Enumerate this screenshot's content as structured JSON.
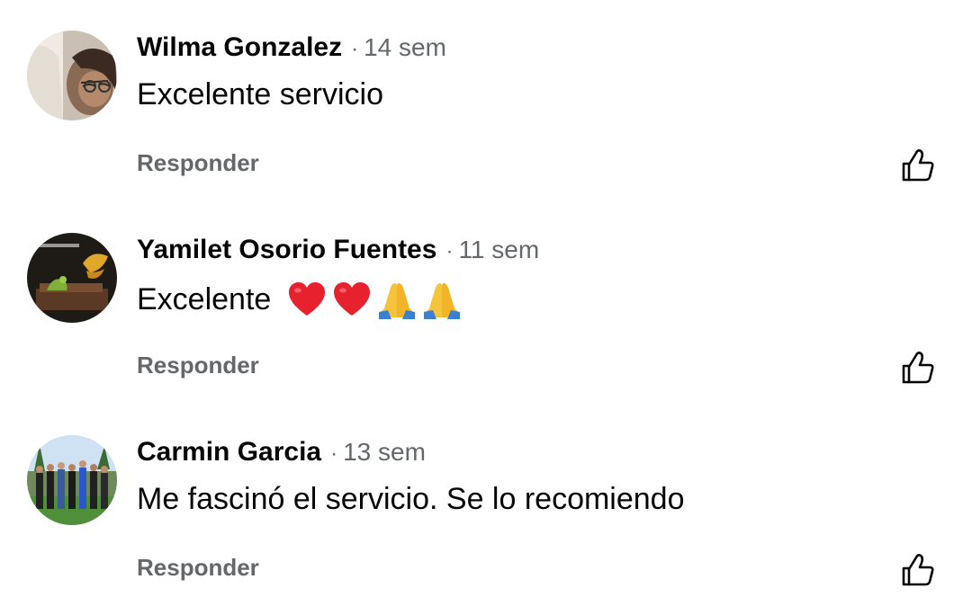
{
  "comments": [
    {
      "author": "Wilma Gonzalez",
      "separator": "·",
      "time": "14 sem",
      "text": "Excelente servicio",
      "emojis": [],
      "reply_label": "Responder",
      "like_icon": "thumbs-up-icon"
    },
    {
      "author": "Yamilet Osorio Fuentes",
      "separator": "·",
      "time": "11 sem",
      "text": "Excelente",
      "emojis": [
        "red-heart",
        "red-heart",
        "folded-hands",
        "folded-hands"
      ],
      "reply_label": "Responder",
      "like_icon": "thumbs-up-icon"
    },
    {
      "author": "Carmin Garcia",
      "separator": "·",
      "time": "13 sem",
      "text": "Me fascinó el servicio. Se lo recomiendo",
      "emojis": [],
      "reply_label": "Responder",
      "like_icon": "thumbs-up-icon"
    }
  ],
  "colors": {
    "text_primary": "#050505",
    "text_secondary": "#65676b",
    "background": "#ffffff"
  }
}
